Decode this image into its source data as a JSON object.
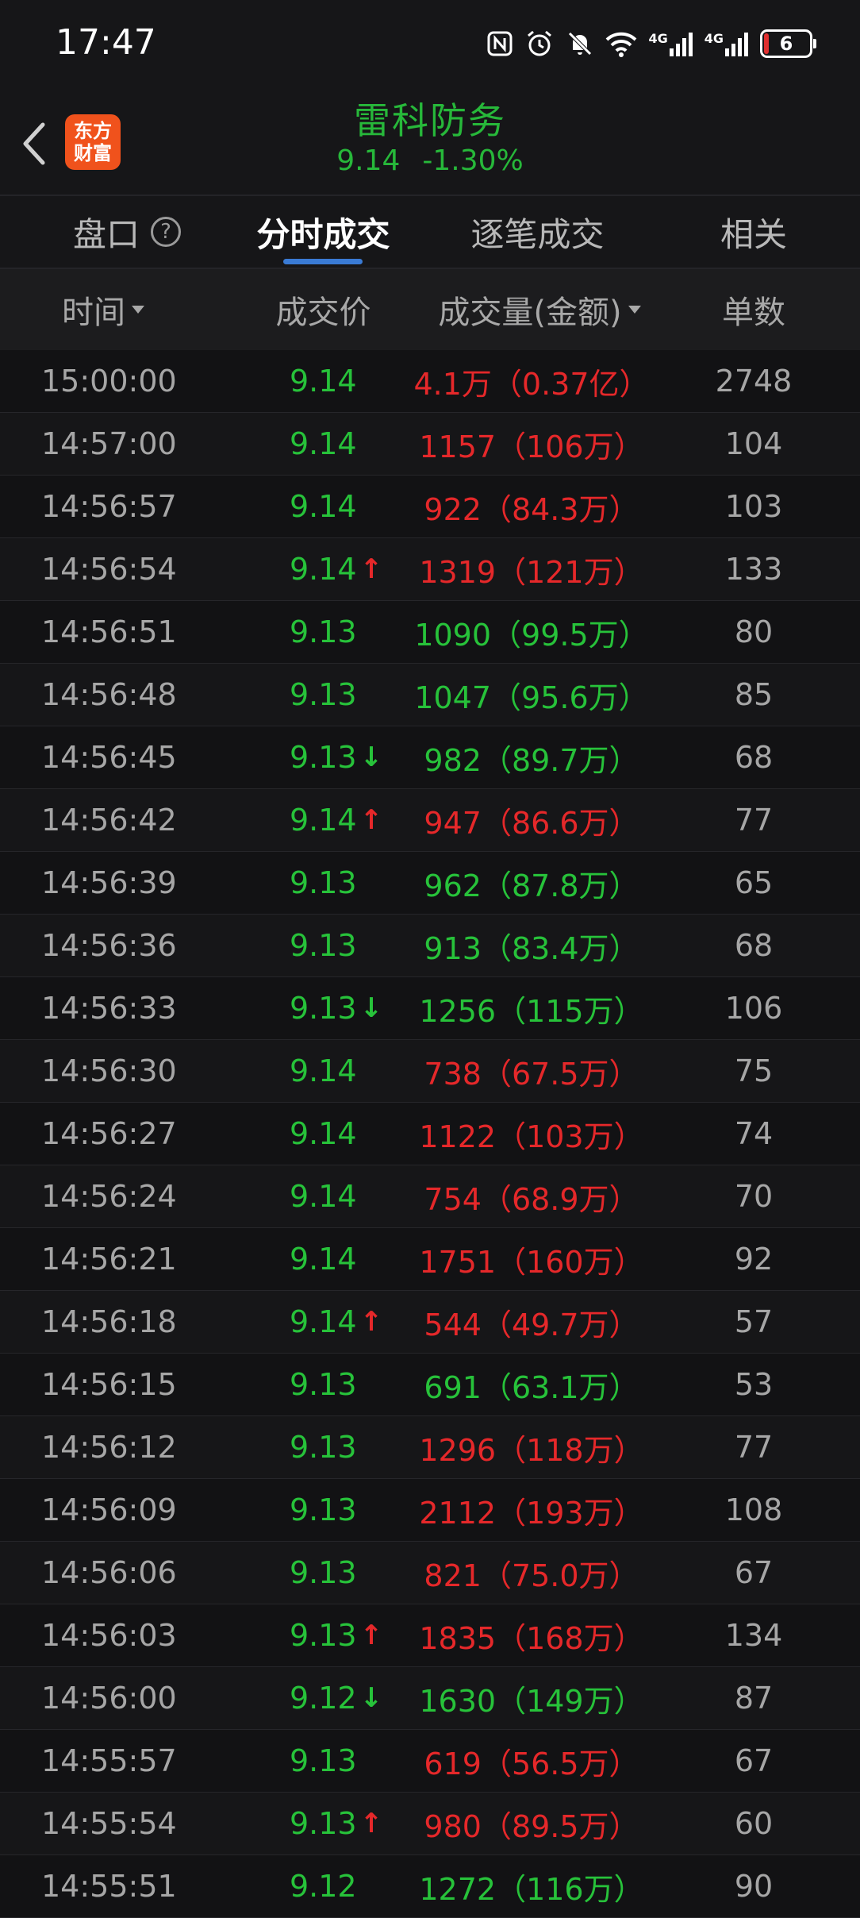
{
  "status_bar": {
    "time": "17:47",
    "battery": "6",
    "net1": "4G",
    "net2": "4G"
  },
  "header": {
    "logo_line1": "东方",
    "logo_line2": "财富",
    "stock_name": "雷科防务",
    "price": "9.14",
    "change": "-1.30%"
  },
  "tabs": [
    {
      "label": "盘口"
    },
    {
      "label": "分时成交"
    },
    {
      "label": "逐笔成交"
    },
    {
      "label": "相关"
    }
  ],
  "columns": {
    "time": "时间",
    "price": "成交价",
    "volume": "成交量(金额)",
    "count": "单数"
  },
  "colors": {
    "up": "#e5282a",
    "down": "#27c23a",
    "accent": "#3a7bd5",
    "brand": "#f0521c"
  },
  "trades": [
    {
      "time": "15:00:00",
      "price": "9.14",
      "arrow": "",
      "volume": "4.1万（0.37亿）",
      "vol_color": "red",
      "count": "2748"
    },
    {
      "time": "14:57:00",
      "price": "9.14",
      "arrow": "",
      "volume": "1157（106万）",
      "vol_color": "red",
      "count": "104"
    },
    {
      "time": "14:56:57",
      "price": "9.14",
      "arrow": "",
      "volume": "922（84.3万）",
      "vol_color": "red",
      "count": "103"
    },
    {
      "time": "14:56:54",
      "price": "9.14",
      "arrow": "↑",
      "volume": "1319（121万）",
      "vol_color": "red",
      "count": "133"
    },
    {
      "time": "14:56:51",
      "price": "9.13",
      "arrow": "",
      "volume": "1090（99.5万）",
      "vol_color": "green",
      "count": "80"
    },
    {
      "time": "14:56:48",
      "price": "9.13",
      "arrow": "",
      "volume": "1047（95.6万）",
      "vol_color": "green",
      "count": "85"
    },
    {
      "time": "14:56:45",
      "price": "9.13",
      "arrow": "↓",
      "volume": "982（89.7万）",
      "vol_color": "green",
      "count": "68"
    },
    {
      "time": "14:56:42",
      "price": "9.14",
      "arrow": "↑",
      "volume": "947（86.6万）",
      "vol_color": "red",
      "count": "77"
    },
    {
      "time": "14:56:39",
      "price": "9.13",
      "arrow": "",
      "volume": "962（87.8万）",
      "vol_color": "green",
      "count": "65"
    },
    {
      "time": "14:56:36",
      "price": "9.13",
      "arrow": "",
      "volume": "913（83.4万）",
      "vol_color": "green",
      "count": "68"
    },
    {
      "time": "14:56:33",
      "price": "9.13",
      "arrow": "↓",
      "volume": "1256（115万）",
      "vol_color": "green",
      "count": "106"
    },
    {
      "time": "14:56:30",
      "price": "9.14",
      "arrow": "",
      "volume": "738（67.5万）",
      "vol_color": "red",
      "count": "75"
    },
    {
      "time": "14:56:27",
      "price": "9.14",
      "arrow": "",
      "volume": "1122（103万）",
      "vol_color": "red",
      "count": "74"
    },
    {
      "time": "14:56:24",
      "price": "9.14",
      "arrow": "",
      "volume": "754（68.9万）",
      "vol_color": "red",
      "count": "70"
    },
    {
      "time": "14:56:21",
      "price": "9.14",
      "arrow": "",
      "volume": "1751（160万）",
      "vol_color": "red",
      "count": "92"
    },
    {
      "time": "14:56:18",
      "price": "9.14",
      "arrow": "↑",
      "volume": "544（49.7万）",
      "vol_color": "red",
      "count": "57"
    },
    {
      "time": "14:56:15",
      "price": "9.13",
      "arrow": "",
      "volume": "691（63.1万）",
      "vol_color": "green",
      "count": "53"
    },
    {
      "time": "14:56:12",
      "price": "9.13",
      "arrow": "",
      "volume": "1296（118万）",
      "vol_color": "red",
      "count": "77"
    },
    {
      "time": "14:56:09",
      "price": "9.13",
      "arrow": "",
      "volume": "2112（193万）",
      "vol_color": "red",
      "count": "108"
    },
    {
      "time": "14:56:06",
      "price": "9.13",
      "arrow": "",
      "volume": "821（75.0万）",
      "vol_color": "red",
      "count": "67"
    },
    {
      "time": "14:56:03",
      "price": "9.13",
      "arrow": "↑",
      "volume": "1835（168万）",
      "vol_color": "red",
      "count": "134"
    },
    {
      "time": "14:56:00",
      "price": "9.12",
      "arrow": "↓",
      "volume": "1630（149万）",
      "vol_color": "green",
      "count": "87"
    },
    {
      "time": "14:55:57",
      "price": "9.13",
      "arrow": "",
      "volume": "619（56.5万）",
      "vol_color": "red",
      "count": "67"
    },
    {
      "time": "14:55:54",
      "price": "9.13",
      "arrow": "↑",
      "volume": "980（89.5万）",
      "vol_color": "red",
      "count": "60"
    },
    {
      "time": "14:55:51",
      "price": "9.12",
      "arrow": "",
      "volume": "1272（116万）",
      "vol_color": "green",
      "count": "90"
    }
  ]
}
